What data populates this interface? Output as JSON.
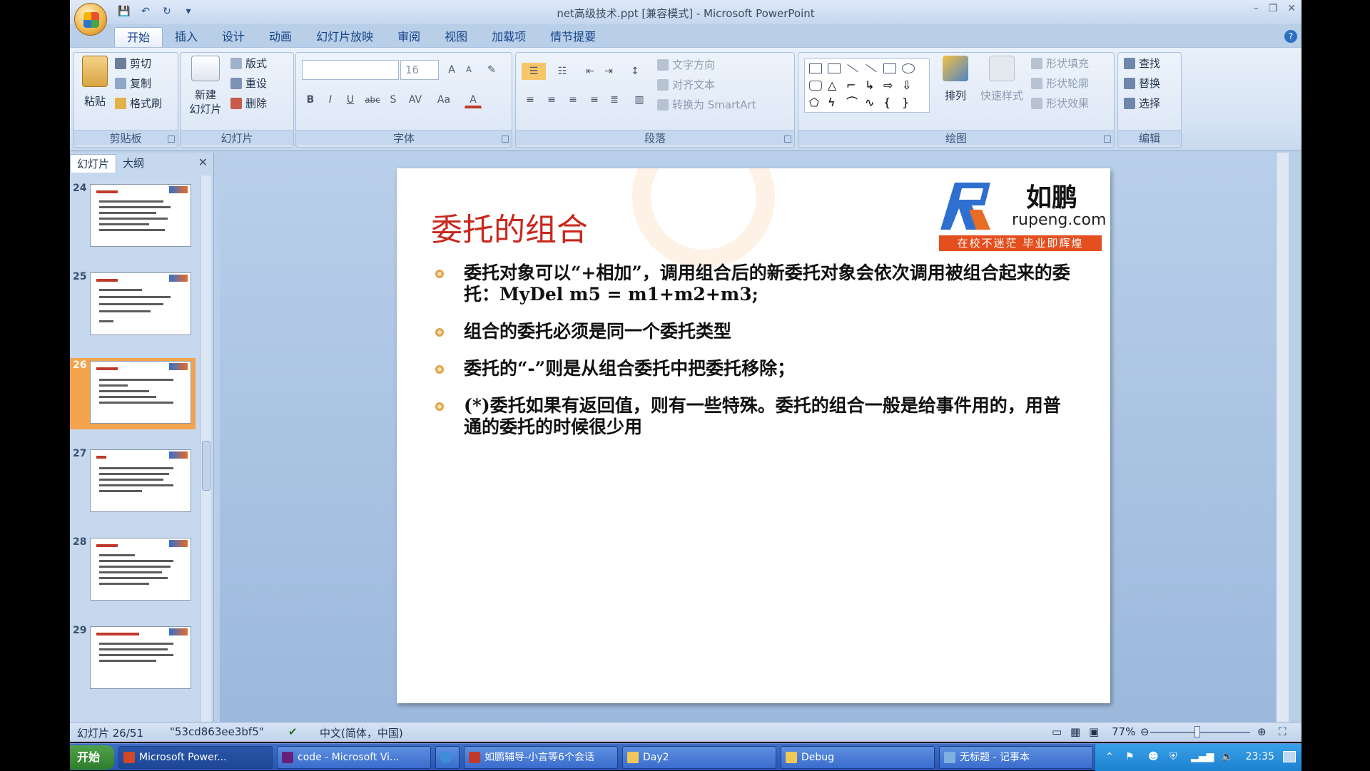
{
  "window": {
    "title": "net高级技术.ppt [兼容模式] - Microsoft PowerPoint",
    "controls": [
      "–",
      "❐",
      "✕"
    ]
  },
  "qat": {
    "save": "💾",
    "undo": "↶",
    "redo": "↻",
    "more": "▾"
  },
  "tabs": [
    "开始",
    "插入",
    "设计",
    "动画",
    "幻灯片放映",
    "审阅",
    "视图",
    "加载项",
    "情节提要"
  ],
  "ribbon": {
    "clipboard": {
      "label": "剪贴板",
      "paste": "粘贴",
      "cut": "剪切",
      "copy": "复制",
      "format_painter": "格式刷"
    },
    "slides": {
      "label": "幻灯片",
      "new_slide": "新建\n幻灯片",
      "layout": "版式",
      "reset": "重设",
      "delete": "删除"
    },
    "font": {
      "label": "字体",
      "font_name": "",
      "font_size": "16",
      "grow": "A",
      "shrink": "A",
      "clear": "✎",
      "bold": "B",
      "italic": "I",
      "underline": "U",
      "strike": "abc",
      "shadow": "S",
      "spacing": "AV",
      "case": "Aa",
      "color": "A"
    },
    "paragraph": {
      "label": "段落",
      "text_direction": "文字方向",
      "align_text": "对齐文本",
      "smartart": "转换为 SmartArt"
    },
    "drawing": {
      "label": "绘图",
      "arrange": "排列",
      "quick_styles": "快速样式",
      "shape_fill": "形状填充",
      "shape_outline": "形状轮廓",
      "shape_effects": "形状效果"
    },
    "editing": {
      "label": "编辑",
      "find": "查找",
      "replace": "替换",
      "select": "选择"
    }
  },
  "left_pane": {
    "tabs": [
      "幻灯片",
      "大纲"
    ],
    "close": "✕",
    "thumbs": [
      {
        "num": "24",
        "selected": false
      },
      {
        "num": "25",
        "selected": false
      },
      {
        "num": "26",
        "selected": true
      },
      {
        "num": "27",
        "selected": false
      },
      {
        "num": "28",
        "selected": false
      },
      {
        "num": "29",
        "selected": false
      }
    ]
  },
  "slide": {
    "title": "委托的组合",
    "logo": {
      "name": "如鹏",
      "url": "rupeng.com",
      "tagline": "在校不迷茫 毕业即辉煌"
    },
    "bullets": [
      "委托对象可以“+相加”，调用组合后的新委托对象会依次调用被组合起来的委托：MyDel m5 = m1+m2+m3;",
      "组合的委托必须是同一个委托类型",
      "委托的“-”则是从组合委托中把委托移除；",
      "(*)委托如果有返回值，则有一些特殊。委托的组合一般是给事件用的，用普通的委托的时候很少用"
    ]
  },
  "status": {
    "slide_pos": "幻灯片 26/51",
    "theme": "\"53cd863ee3bf5\"",
    "language": "中文(简体，中国)",
    "zoom": "77%"
  },
  "taskbar": {
    "start": "开始",
    "items": [
      {
        "label": "Microsoft Power...",
        "color": "#d24726",
        "active": true
      },
      {
        "label": "code - Microsoft Vi...",
        "color": "#68217a",
        "active": false
      },
      {
        "label": "",
        "color": "#3a8fd8",
        "active": false
      },
      {
        "label": "如鹏辅导-小言等6个会话",
        "color": "#c0392b",
        "active": false
      },
      {
        "label": "Day2",
        "color": "#f0c85a",
        "active": false
      },
      {
        "label": "Debug",
        "color": "#f0c85a",
        "active": false
      },
      {
        "label": "无标题 - 记事本",
        "color": "#7fb0e0",
        "active": false
      }
    ],
    "clock": "23:35"
  },
  "colors": {
    "title_red": "#c9271c",
    "accent_orange": "#f2a34c",
    "ribbon_blue": "#15428b"
  }
}
